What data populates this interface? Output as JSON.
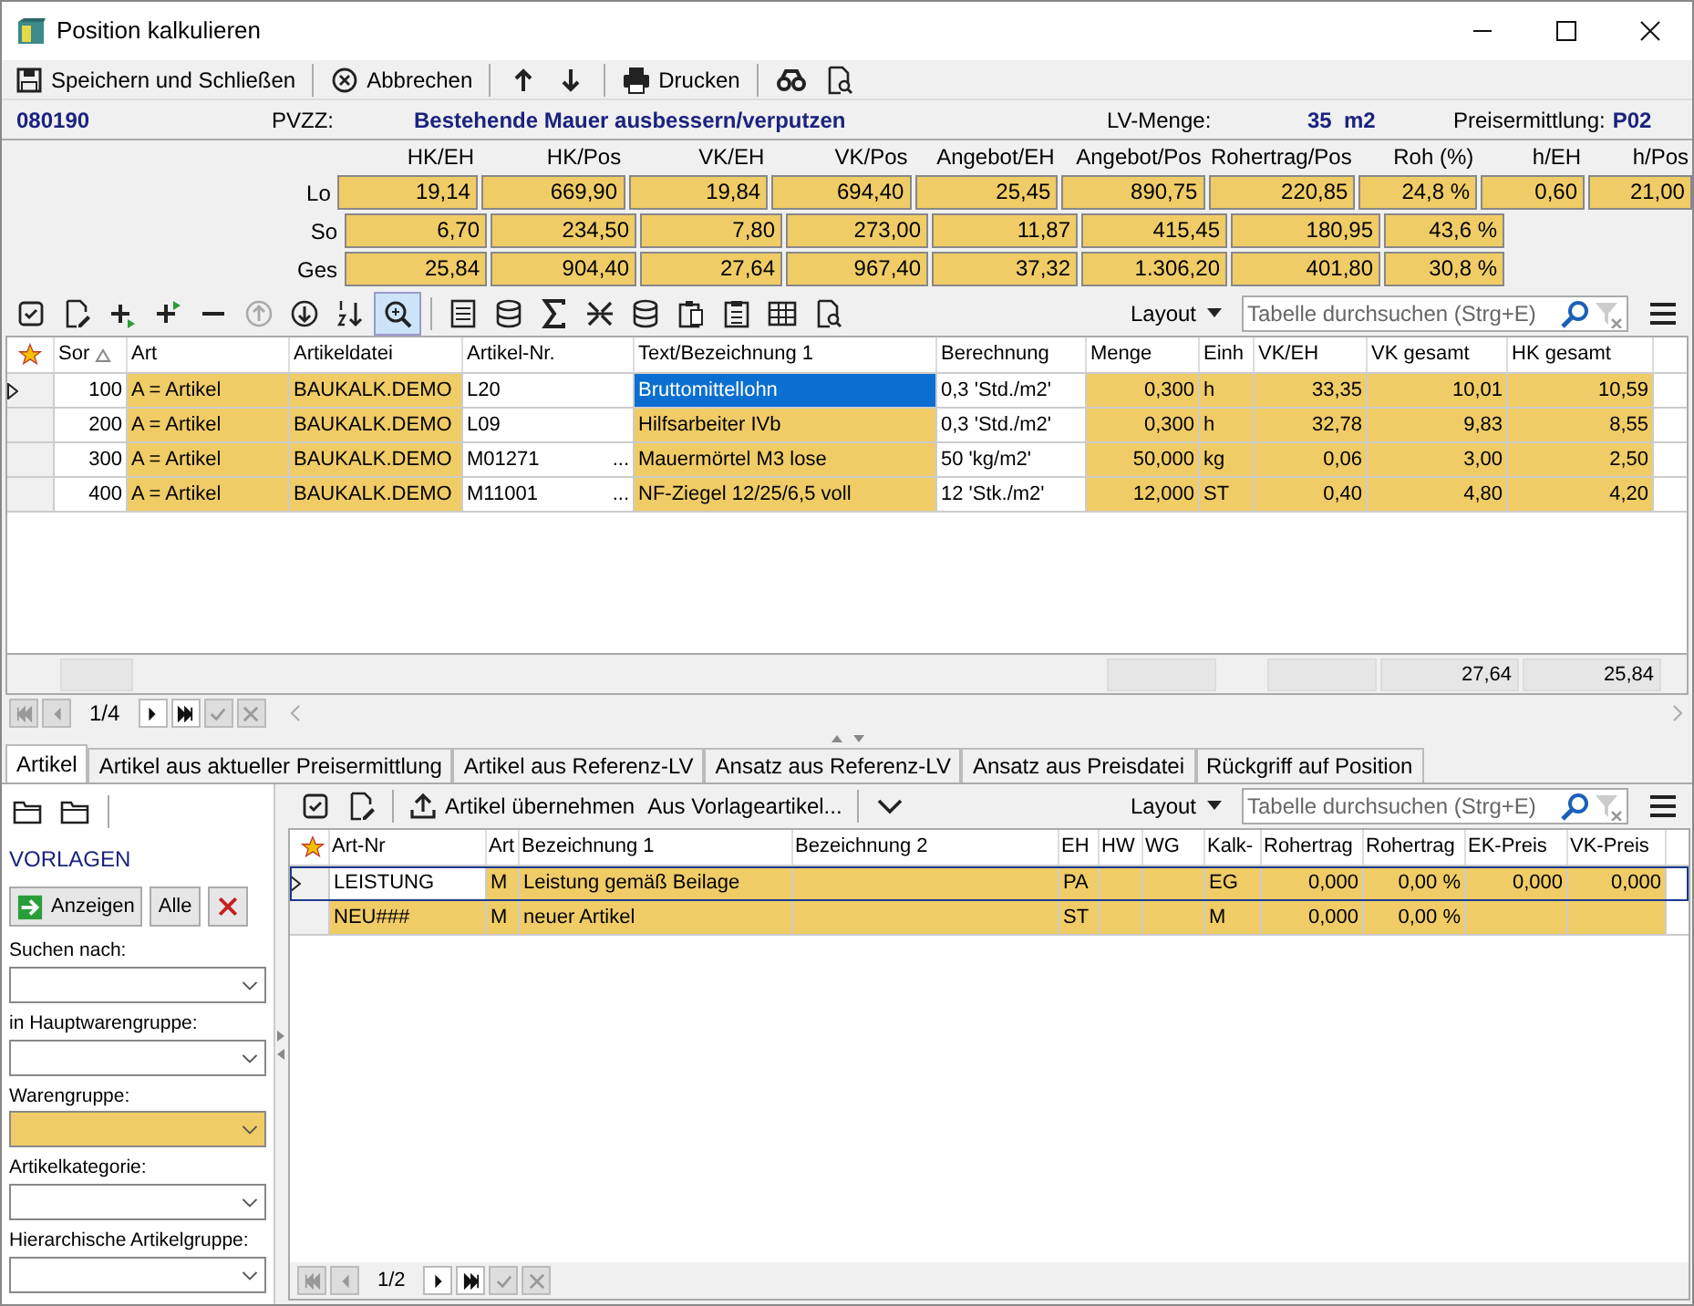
{
  "window": {
    "title": "Position kalkulieren"
  },
  "toolbar": [
    "Speichern und Schließen",
    "Abbrechen",
    "Drucken"
  ],
  "header": {
    "code": "080190",
    "pvzz_label": "PVZZ:",
    "description": "Bestehende Mauer ausbessern/verputzen",
    "lv_menge_label": "LV-Menge:",
    "lv_menge": "35  m2",
    "preis_label": "Preisermittlung:",
    "preis_value": "P02"
  },
  "summary": {
    "columns": [
      "HK/EH",
      "HK/Pos",
      "VK/EH",
      "VK/Pos",
      "Angebot/EH",
      "Angebot/Pos",
      "Rohertrag/Pos",
      "Roh (%)",
      "h/EH",
      "h/Pos"
    ],
    "rows": [
      {
        "label": "Lo",
        "cells": [
          "19,14",
          "669,90",
          "19,84",
          "694,40",
          "25,45",
          "890,75",
          "220,85",
          "24,8 %",
          "0,60",
          "21,00"
        ]
      },
      {
        "label": "So",
        "cells": [
          "6,70",
          "234,50",
          "7,80",
          "273,00",
          "11,87",
          "415,45",
          "180,95",
          "43,6 %"
        ]
      },
      {
        "label": "Ges",
        "cells": [
          "25,84",
          "904,40",
          "27,64",
          "967,40",
          "37,32",
          "1.306,20",
          "401,80",
          "30,8 %"
        ]
      }
    ]
  },
  "positions_grid": {
    "layout": "Layout",
    "search_placeholder": "Tabelle durchsuchen (Strg+E)",
    "columns": [
      {
        "label": "Sor",
        "editable": true
      },
      {
        "label": "Art",
        "editable": false
      },
      {
        "label": "Artikeldatei",
        "editable": false
      },
      {
        "label": "Artikel-Nr.",
        "editable": true
      },
      {
        "label": "Text/Bezeichnung 1",
        "editable": false,
        "focused": true
      },
      {
        "label": "Berechnung",
        "editable": true
      },
      {
        "label": "Menge",
        "editable": false
      },
      {
        "label": "Einh",
        "editable": false
      },
      {
        "label": "VK/EH",
        "editable": false
      },
      {
        "label": "VK gesamt",
        "editable": false
      },
      {
        "label": "HK gesamt",
        "editable": false
      }
    ],
    "rows": [
      {
        "selected": true,
        "cells": [
          "100",
          "A = Artikel",
          "BAUKALK.DEMO",
          "L20",
          "Bruttomittellohn",
          "0,3 'Std./m2'",
          "0,300",
          "h",
          "33,35",
          "10,01",
          "10,59"
        ]
      },
      {
        "selected": false,
        "cells": [
          "200",
          "A = Artikel",
          "BAUKALK.DEMO",
          "L09",
          "Hilfsarbeiter IVb",
          "0,3 'Std./m2'",
          "0,300",
          "h",
          "32,78",
          "9,83",
          "8,55"
        ]
      },
      {
        "selected": false,
        "cells": [
          "300",
          "A = Artikel",
          "BAUKALK.DEMO",
          "M01271",
          "Mauermörtel M3 lose",
          "50 'kg/m2'",
          "50,000",
          "kg",
          "0,06",
          "3,00",
          "2,50"
        ],
        "lookup": "..."
      },
      {
        "selected": false,
        "cells": [
          "400",
          "A = Artikel",
          "BAUKALK.DEMO",
          "M11001",
          "NF-Ziegel 12/25/6,5 voll",
          "12 'Stk./m2'",
          "12,000",
          "ST",
          "0,40",
          "4,80",
          "4,20"
        ],
        "lookup": "..."
      }
    ],
    "totals": [
      "27,64",
      "25,84"
    ],
    "pager": "1/4"
  },
  "tabs": [
    {
      "label": "Artikel",
      "selected": true
    },
    {
      "label": "Artikel aus aktueller Preisermittlung",
      "selected": false
    },
    {
      "label": "Artikel aus Referenz-LV",
      "selected": false
    },
    {
      "label": "Ansatz aus Referenz-LV",
      "selected": false
    },
    {
      "label": "Ansatz aus Preisdatei",
      "selected": false
    },
    {
      "label": "Rückgriff auf Position",
      "selected": false
    }
  ],
  "filter_panel": {
    "title": "VORLAGEN",
    "buttons": [
      "Anzeigen",
      "Alle"
    ],
    "fields": [
      {
        "label": "Suchen nach:",
        "highlighted": false
      },
      {
        "label": "in Hauptwarengruppe:",
        "highlighted": false
      },
      {
        "label": "Warengruppe:",
        "highlighted": true
      },
      {
        "label": "Artikelkategorie:",
        "highlighted": false
      },
      {
        "label": "Hierarchische Artikelgruppe:",
        "highlighted": false
      }
    ]
  },
  "articles_grid": {
    "actions": [
      "Artikel übernehmen",
      "Aus Vorlageartikel..."
    ],
    "layout": "Layout",
    "search_placeholder": "Tabelle durchsuchen (Strg+E)",
    "columns": [
      {
        "label": "Art-Nr",
        "focused": true
      },
      {
        "label": "Art",
        "focused": false
      },
      {
        "label": "Bezeichnung 1",
        "focused": false
      },
      {
        "label": "Bezeichnung 2",
        "focused": false
      },
      {
        "label": "EH",
        "focused": false
      },
      {
        "label": "HW",
        "focused": false
      },
      {
        "label": "WG",
        "focused": false
      },
      {
        "label": "Kalk-",
        "focused": false
      },
      {
        "label": "Rohertrag",
        "focused": false
      },
      {
        "label": "Rohertrag",
        "focused": false
      },
      {
        "label": "EK-Preis",
        "focused": false
      },
      {
        "label": "VK-Preis",
        "focused": false
      }
    ],
    "rows": [
      {
        "selected": true,
        "cells": [
          "LEISTUNG",
          "M",
          "Leistung gemäß Beilage",
          "",
          "PA",
          "",
          "",
          "EG",
          "0,000",
          "0,00 %",
          "0,000",
          "0,000"
        ]
      },
      {
        "selected": false,
        "cells": [
          "NEU###",
          "M",
          "neuer Artikel",
          "",
          "ST",
          "",
          "",
          "M",
          "0,000",
          "0,00 %",
          "",
          ""
        ]
      }
    ],
    "pager": "1/2"
  }
}
